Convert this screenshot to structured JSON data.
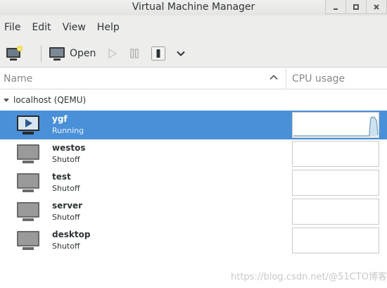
{
  "window": {
    "title": "Virtual Machine Manager",
    "controls": [
      "minimize",
      "maximize",
      "close"
    ]
  },
  "menubar": {
    "items": [
      "File",
      "Edit",
      "View",
      "Help"
    ]
  },
  "toolbar": {
    "open_label": "Open",
    "icons": [
      "new-vm-icon",
      "open-console-icon",
      "run-icon",
      "pause-icon",
      "shutdown-icon",
      "chevron-down-icon"
    ]
  },
  "columns": {
    "name": "Name",
    "cpu": "CPU usage"
  },
  "group": {
    "label": "localhost (QEMU)"
  },
  "vms": [
    {
      "name": "ygf",
      "status": "Running",
      "selected": true
    },
    {
      "name": "westos",
      "status": "Shutoff",
      "selected": false
    },
    {
      "name": "test",
      "status": "Shutoff",
      "selected": false
    },
    {
      "name": "server",
      "status": "Shutoff",
      "selected": false
    },
    {
      "name": "desktop",
      "status": "Shutoff",
      "selected": false
    }
  ],
  "cpu_graph": {
    "ygf": [
      0,
      0,
      0,
      0,
      0,
      0,
      0,
      0,
      0,
      0,
      0,
      0,
      0,
      0,
      0,
      0,
      0,
      0,
      0,
      0,
      0,
      0,
      0,
      0,
      0,
      0,
      0,
      0,
      0,
      0,
      0,
      0,
      0,
      0,
      0,
      0,
      0,
      0,
      0,
      0,
      0,
      0,
      0,
      0,
      0,
      0,
      0,
      0,
      0,
      0,
      0,
      0,
      0,
      0,
      0,
      0,
      0,
      0,
      0,
      0,
      0,
      0,
      0,
      0.9,
      1.0,
      0.95,
      1.0,
      0.9,
      0.8,
      0.05
    ]
  },
  "colors": {
    "selection": "#4a90d9",
    "cpu_line": "#7aa7c7",
    "cpu_fill": "#cfe1ee"
  },
  "watermark": "https://blog.csdn.net/@51CTO博客"
}
